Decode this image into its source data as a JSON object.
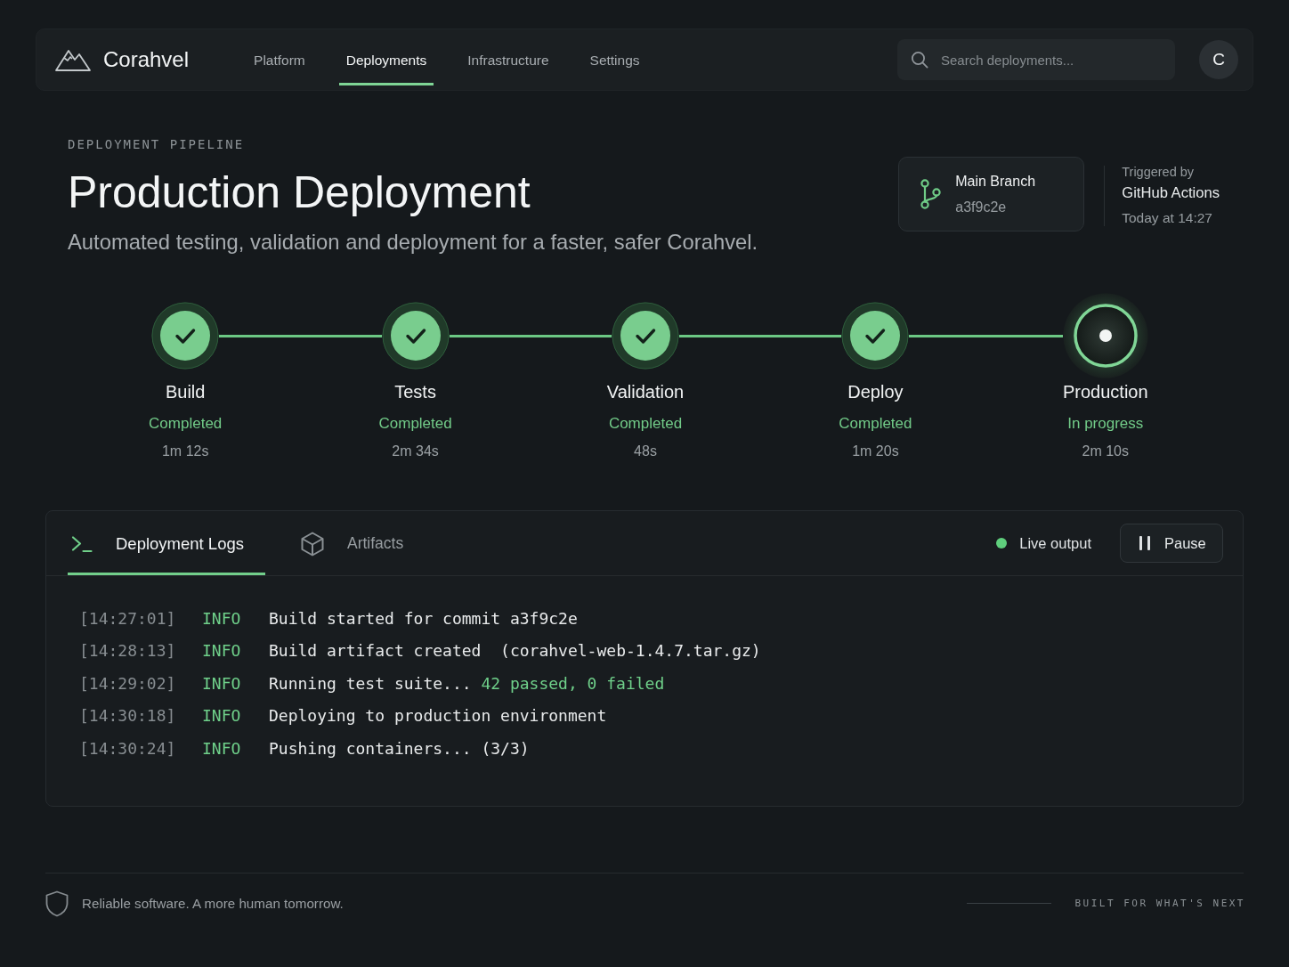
{
  "nav": {
    "brand": "Corahvel",
    "links": [
      {
        "label": "Platform",
        "selected": false
      },
      {
        "label": "Deployments",
        "selected": true
      },
      {
        "label": "Infrastructure",
        "selected": false
      },
      {
        "label": "Settings",
        "selected": false
      }
    ],
    "search": {
      "placeholder": "Search deployments..."
    },
    "avatar": {
      "initial": "C"
    }
  },
  "header": {
    "eyebrow": "DEPLOYMENT PIPELINE",
    "title": "Production Deployment",
    "subtitle": "Automated testing, validation and deployment for a faster, safer Corahvel."
  },
  "branch": {
    "name": "Main Branch",
    "commit": "a3f9c2e"
  },
  "trigger": {
    "label": "Triggered by",
    "source": "GitHub Actions",
    "time": "Today at 14:27"
  },
  "pipeline": {
    "stages": [
      {
        "name": "Build",
        "status": "Completed",
        "duration": "1m 12s",
        "kind": "completed"
      },
      {
        "name": "Tests",
        "status": "Completed",
        "duration": "2m 34s",
        "kind": "completed"
      },
      {
        "name": "Validation",
        "status": "Completed",
        "duration": "48s",
        "kind": "completed"
      },
      {
        "name": "Deploy",
        "status": "Completed",
        "duration": "1m 20s",
        "kind": "completed"
      },
      {
        "name": "Production",
        "status": "In progress",
        "duration": "2m 10s",
        "kind": "active"
      }
    ]
  },
  "logs": {
    "tabs": [
      {
        "label": "Deployment Logs",
        "selected": true
      },
      {
        "label": "Artifacts",
        "selected": false
      }
    ],
    "live": {
      "label": "Live output",
      "on": true
    },
    "pause_button": {
      "label": "Pause"
    },
    "lines": [
      {
        "time": "[14:27:01]",
        "level": "INFO",
        "message": "Build started for commit a3f9c2e"
      },
      {
        "time": "[14:28:13]",
        "level": "INFO",
        "message": "Build artifact created  (corahvel-web-1.4.7.tar.gz)"
      },
      {
        "time": "[14:29:02]",
        "level": "INFO",
        "message": "Running test suite...",
        "result": "42 passed, 0 failed"
      },
      {
        "time": "[14:30:18]",
        "level": "INFO",
        "message": "Deploying to production environment"
      },
      {
        "time": "[14:30:24]",
        "level": "INFO",
        "message": "Pushing containers... (3/3)"
      }
    ]
  },
  "footer": {
    "tagline": "Reliable software. A more human tomorrow.",
    "motto": "BUILT FOR WHAT'S NEXT"
  }
}
